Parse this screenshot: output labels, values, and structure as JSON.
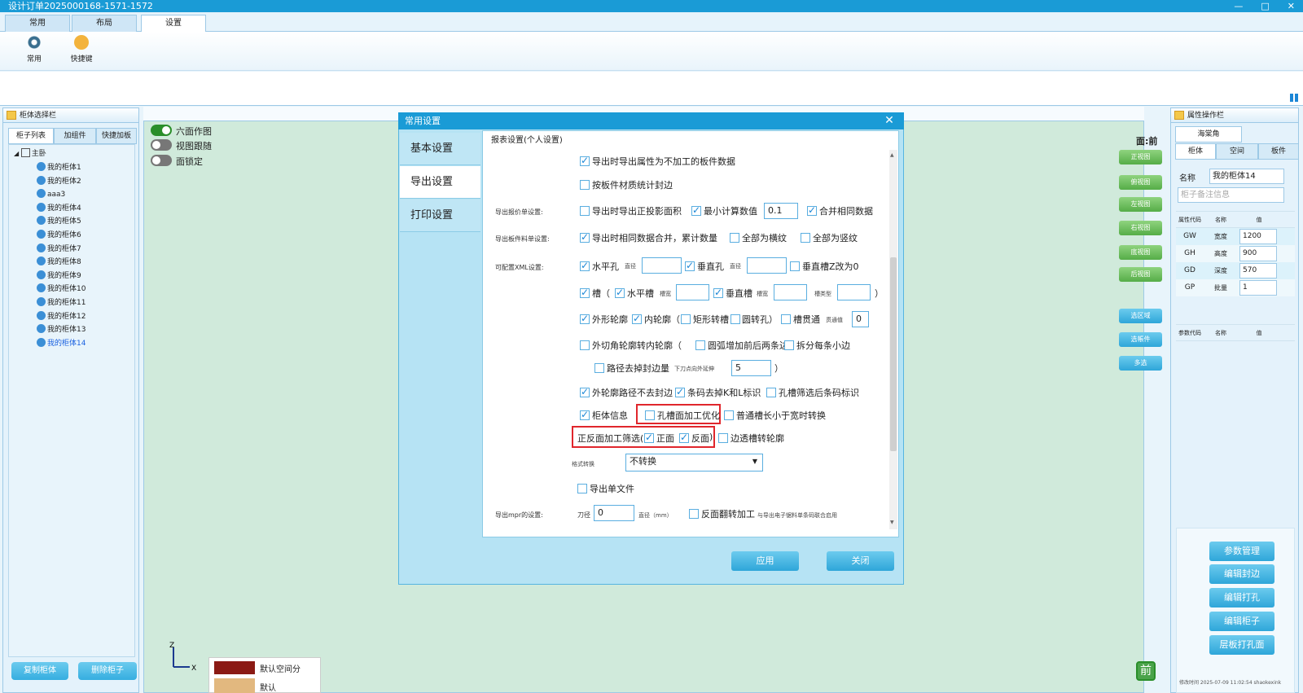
{
  "window": {
    "title": "设计订单2025000168-1571-1572"
  },
  "ribbon": {
    "tabs": [
      "常用",
      "布局",
      "设置"
    ],
    "buttons": [
      {
        "label": "常用",
        "icon": "gear-icon"
      },
      {
        "label": "快捷键",
        "icon": "keyboard-icon"
      }
    ]
  },
  "left_panel": {
    "title": "柜体选择栏",
    "tabs": [
      "柜子列表",
      "加组件",
      "快捷加板"
    ],
    "tree_root": "主卧",
    "items": [
      "我的柜体1",
      "我的柜体2",
      "aaa3",
      "我的柜体4",
      "我的柜体5",
      "我的柜体6",
      "我的柜体7",
      "我的柜体8",
      "我的柜体9",
      "我的柜体10",
      "我的柜体11",
      "我的柜体12",
      "我的柜体13",
      "我的柜体14"
    ],
    "copy_button": "复制柜体",
    "delete_button": "删除柜子"
  },
  "canvas": {
    "toggles": [
      {
        "label": "六面作图",
        "on": true
      },
      {
        "label": "视图跟随",
        "on": false
      },
      {
        "label": "面锁定",
        "on": false
      }
    ],
    "face_label": "面:前",
    "view_buttons": [
      "正视图",
      "俯视图",
      "左视图",
      "右视图",
      "底视图",
      "后视图"
    ],
    "tool_buttons": [
      "选区域",
      "选帳件",
      "多选"
    ],
    "legend": [
      "默认空间分",
      "默认"
    ],
    "corner_badge": "前"
  },
  "right_panel": {
    "title": "属性操作栏",
    "top_tab": "海棠角",
    "tabs": [
      "柜体",
      "空间",
      "板件"
    ],
    "name_label": "名称",
    "name_value": "我的柜体14",
    "remark_placeholder": "柜子备注信息",
    "table_headers": [
      "属性代码",
      "名称",
      "值"
    ],
    "rows": [
      {
        "code": "GW",
        "name": "宽度",
        "value": "1200"
      },
      {
        "code": "GH",
        "name": "高度",
        "value": "900"
      },
      {
        "code": "GD",
        "name": "深度",
        "value": "570"
      },
      {
        "code": "GP",
        "name": "批量",
        "value": "1"
      }
    ],
    "param_headers": [
      "参数代码",
      "名称",
      "值"
    ],
    "actions": [
      "参数管理",
      "编辑封边",
      "编辑打孔",
      "编辑柜子",
      "层板打孔面"
    ],
    "footer": "修改时间 2025-07-09 11:02:54 shaokexink"
  },
  "dialog": {
    "title": "常用设置",
    "tabs": [
      "基本设置",
      "导出设置",
      "打印设置"
    ],
    "section": "报表设置(个人设置)",
    "apply": "应用",
    "close": "关闭",
    "labels": {
      "quote": "导出报价单设置:",
      "material": "导出板件料单设置:",
      "xml": "可配置XML设置:",
      "mpr": "导出mpr的设置:"
    },
    "opts": {
      "o1": "导出时导出属性为不加工的板件数据",
      "o2": "按板件材质统计封边",
      "o3": "导出时导出正投影面积",
      "o4": "最小计算数值",
      "o4v": "0.1",
      "o5": "合并相同数据",
      "o6": "导出时相同数据合并，累计数量",
      "o7": "全部为横纹",
      "o8": "全部为竖纹",
      "o9": "水平孔",
      "dia": "直径",
      "o10": "垂直孔",
      "o11": "垂直槽Z改为0",
      "o12": "槽（",
      "o13": "水平槽",
      "groove_w": "槽宽",
      "o14": "垂直槽",
      "groove_type": "槽类型",
      "close_paren": "）",
      "o15": "外形轮廓",
      "o16": "内轮廓（",
      "o17": "矩形转槽",
      "o18": "圆转孔",
      "o18b": "）",
      "o19": "槽贯通",
      "thru": "贯通值",
      "thru_v": "0",
      "o20": "外切角轮廓转内轮廓（",
      "o21": "圆弧增加前后两条边",
      "o22": "拆分每条小边",
      "o23": "路径去掉封边量",
      "o23b": "下刀点向外延伸",
      "o23v": "5",
      "o23c": "）",
      "o24": "外轮廓路径不去封边",
      "o25": "条码去掉K和L标识",
      "o26": "孔槽筛选后条码标识",
      "o27": "柜体信息",
      "o28": "孔槽面加工优化",
      "o29": "普通槽长小于宽时转换",
      "o30": "正反面加工筛选(",
      "o31": "正面",
      "o32": "反面",
      "o32b": ")",
      "o33": "边透槽转轮廓",
      "fmt": "格式转换",
      "fmt_v": "不转换",
      "o34": "导出单文件",
      "knife": "刀径",
      "knife_v": "0",
      "knife_unit": "直径（mm）",
      "o35": "反面翻转加工",
      "o35b": "与导出电子锯料单条码联合启用"
    }
  }
}
